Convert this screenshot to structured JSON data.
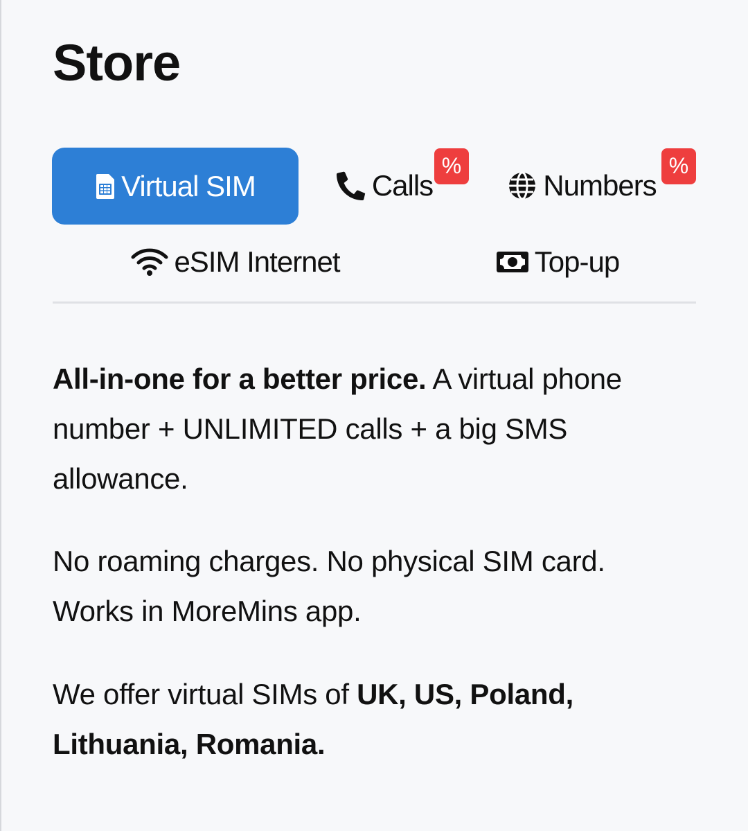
{
  "page": {
    "title": "Store"
  },
  "tabs": [
    {
      "label": "Virtual SIM",
      "icon": "sim-card-icon",
      "active": true
    },
    {
      "label": "Calls",
      "icon": "phone-icon",
      "badge": "%"
    },
    {
      "label": "Numbers",
      "icon": "globe-icon",
      "badge": "%"
    },
    {
      "label": "eSIM Internet",
      "icon": "wifi-icon"
    },
    {
      "label": "Top-up",
      "icon": "money-icon"
    }
  ],
  "content": {
    "p1_bold": "All-in-one for a better price.",
    "p1_rest": " A virtual phone number + UNLIMITED calls + a big SMS allowance.",
    "p2": "No roaming charges. No physical SIM card. Works in MoreMins app.",
    "p3_start": "We offer virtual SIMs of ",
    "p3_bold": "UK, US, Poland, Lithuania, Romania."
  },
  "colors": {
    "accent": "#2d7fd6",
    "badge": "#ee3e3e",
    "background": "#f7f8fa"
  }
}
